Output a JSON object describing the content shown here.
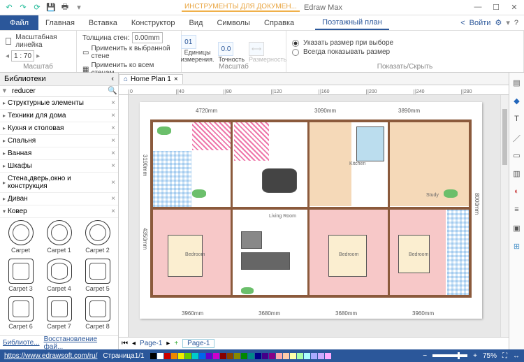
{
  "title": {
    "tool_context": "ИНСТРУМЕНТЫ ДЛЯ ДОКУМЕН...",
    "app": "Edraw Max"
  },
  "menus": {
    "file": "Файл",
    "home": "Главная",
    "insert": "Вставка",
    "constructor": "Конструктор",
    "view": "Вид",
    "symbols": "Символы",
    "help": "Справка",
    "ctx": "Поэтажный план"
  },
  "login": "Войти",
  "ribbon": {
    "g1": {
      "scale_label": "Масштабная линейка",
      "ratio": "1 : 70",
      "group": "Масштаб"
    },
    "g2": {
      "wall_thick": "Толщина стен:",
      "thick_val": "0.00mm",
      "apply_sel": "Применить к выбранной стене",
      "apply_all": "Применить ко всем стенам",
      "group": "Масштаб"
    },
    "g3": {
      "units": "Единицы измерения.",
      "precision": "Точность",
      "dimension": "Размерность",
      "group": "Масштаб"
    },
    "g4": {
      "opt1": "Указать размер при выборе",
      "opt2": "Всегда показывать размер",
      "group": "Показать/Скрыть"
    }
  },
  "library": {
    "title": "Библиотеки",
    "search": "reducer",
    "cats": [
      "Структурные элементы",
      "Техники для дома",
      "Кухня и столовая",
      "Спальня",
      "Ванная",
      "Шкафы",
      "Стена,дверь,окно и конструкция",
      "Диван",
      "Ковер"
    ],
    "shapes": [
      "Carpet",
      "Carpet 1",
      "Carpet 2",
      "Carpet 3",
      "Carpet 4",
      "Carpet 5",
      "Carpet 6",
      "Carpet 7",
      "Carpet 8"
    ],
    "more": "Библиоте...",
    "restore": "Восстановление фай..."
  },
  "doctab": "Home Plan 1",
  "ruler_marks": [
    "0",
    "|40",
    "|80",
    "|120",
    "|160",
    "|200",
    "|240",
    "|280"
  ],
  "roomlabels": {
    "kitchen": "Kitchen",
    "living": "Living Room",
    "bedroom": "Bedroom",
    "study": "Study"
  },
  "dims": {
    "top": "4720mm",
    "top2": "3090mm",
    "top3": "3890mm",
    "left": "3190mm",
    "left2": "4350mm",
    "right": "8000mm",
    "bot1": "3960mm",
    "bot2": "3680mm",
    "bot3": "3680mm",
    "bot4": "3960mm"
  },
  "pages": {
    "p1": "Page-1",
    "p2": "Page-1"
  },
  "status": {
    "url": "https://www.edrawsoft.com/ru/",
    "page": "Страница1/1",
    "zoom": "75%"
  }
}
